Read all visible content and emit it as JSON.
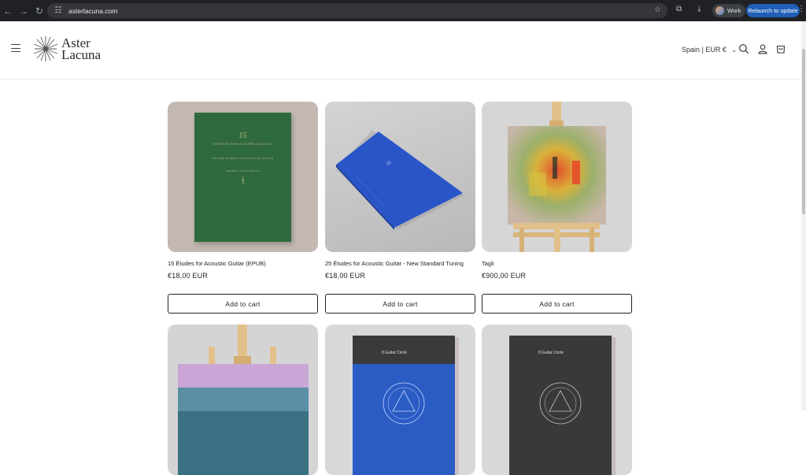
{
  "browser": {
    "url": "asterlacuna.com",
    "profile_label": "Work",
    "relaunch_label": "Relaunch to update"
  },
  "site": {
    "logo_line1": "Aster",
    "logo_line2": "Lacuna",
    "locale": "Spain | EUR €"
  },
  "products": [
    {
      "title": "15 Études for Acoustic Guitar (EPUB)",
      "price": "€18,00 EUR",
      "button": "Add to cart"
    },
    {
      "title": "25 Études for Acoustic Guitar - New Standard Tuning",
      "price": "€18,00 EUR",
      "button": "Add to cart"
    },
    {
      "title": "Tagli",
      "price": "€900,00 EUR",
      "button": "Add to cart"
    }
  ],
  "book_covers": {
    "green_number": "15",
    "green_title": "ESTUDIOS PARA GUITARRA ACÚSTICA",
    "green_subtitle": "FIFTEEN ÉTUDES FOR ACOUSTIC GUITAR",
    "green_author": "ANDRÉS CONSTERLLO",
    "blue_number": "25",
    "guitar_circle_title": "8 Guitar Circle"
  },
  "colors": {
    "accent_blue": "#1f5fb8",
    "cover_green": "#2e6a3d",
    "cover_blue": "#2a55c9"
  }
}
